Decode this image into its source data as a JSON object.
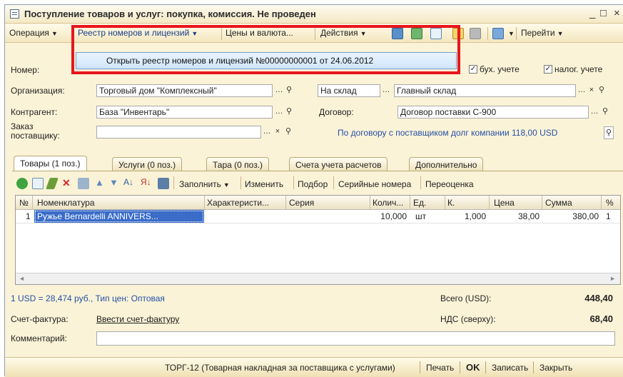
{
  "window": {
    "title": "Поступление товаров и услуг: покупка, комиссия. Не проведен",
    "minimize": "_",
    "maximize": "□",
    "close": "×"
  },
  "toolbar": {
    "operation": "Операция",
    "registry": "Реестр номеров и лицензий",
    "prices": "Цены и валюта...",
    "actions": "Действия",
    "goto": "Перейти"
  },
  "dropdown": {
    "item": "Открыть реестр номеров и лицензий №00000000001 от 24.06.2012"
  },
  "header": {
    "number_label": "Номер:",
    "buh_label": "бух. учете",
    "nalog_label": "налог. учете",
    "org_label": "Организация:",
    "org_value": "Торговый дом \"Комплексный\"",
    "warehouse_type": "На склад",
    "warehouse_value": "Главный склад",
    "contractor_label": "Контрагент:",
    "contractor_value": "База \"Инвентарь\"",
    "contract_label": "Договор:",
    "contract_value": "Договор поставки С-900",
    "order_label_1": "Заказ",
    "order_label_2": "поставщику:",
    "debt_info": "По договору с поставщиком долг компании 118,00 USD"
  },
  "tabs": [
    {
      "label": "Товары (1 поз.)"
    },
    {
      "label": "Услуги (0 поз.)"
    },
    {
      "label": "Тара (0 поз.)"
    },
    {
      "label": "Счета учета расчетов"
    },
    {
      "label": "Дополнительно"
    }
  ],
  "subtoolbar": {
    "fill": "Заполнить",
    "change": "Изменить",
    "select": "Подбор",
    "serials": "Серийные номера",
    "revaluation": "Переоценка"
  },
  "table": {
    "columns": [
      "№",
      "Номенклатура",
      "Характеристи...",
      "Серия",
      "Колич...",
      "Ед.",
      "К.",
      "Цена",
      "Сумма",
      "%"
    ],
    "rows": [
      [
        "1",
        "Ружье Bernardelli ANNIVERS...",
        "",
        "",
        "10,000",
        "шт",
        "1,000",
        "38,00",
        "380,00",
        "1"
      ]
    ]
  },
  "totals": {
    "rate_info": "1 USD = 28,474 руб., Тип цен: Оптовая",
    "total_label": "Всего (USD):",
    "total_value": "448,40",
    "vat_label": "НДС (сверху):",
    "vat_value": "68,40",
    "invoice_label": "Счет-фактура:",
    "invoice_link": "Ввести счет-фактуру",
    "comment_label": "Комментарий:"
  },
  "footer": {
    "torg12": "ТОРГ-12 (Товарная накладная за поставщика с услугами)",
    "print": "Печать",
    "ok": "OK",
    "save": "Записать",
    "close": "Закрыть"
  },
  "colors": {
    "highlight": "#e8161d",
    "window_bg": "#fbf3d7",
    "link": "#2450a8",
    "selected_row": "#3a6cc8"
  }
}
